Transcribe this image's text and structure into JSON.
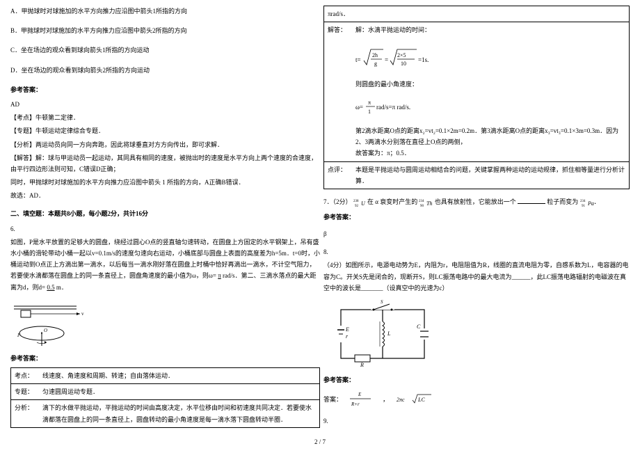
{
  "left": {
    "optA": "A．甲抛球时对球施加的水平方向推力应沿图中箭头1所指的方向",
    "optB": "B．甲抛球时对球施加的水平方向推力应沿图中箭头2所指的方向",
    "optC": "C．坐在场边的观众看到球向箭头1所指的方向运动",
    "optD": "D．坐在场边的观众看到球向箭头2所指的方向运动",
    "answer_label": "参考答案：",
    "answer_val": "AD",
    "exam_point": "【考点】牛顿第二定律．",
    "topic": "【专题】牛顿运动定律综合专题．",
    "analysis": "【分析】两运动员向同一方向奔跑，因此将球垂直对方方向传出，即可求解．",
    "solve1": "【解答】解：球与甲运动员一起运动，其同具有相同的速度，被抛出时的速度是水平方向上两个速度的合速度，由平行四边形法则可知，C错误D正确；",
    "solve2": "同时，甲抛球时对球施加的水平方向推力应沿图中箭头 1 所指的方向，A正确B错误．",
    "conclusion": "故选：AD．",
    "section2": "二、填空题：本题共8小题，每小题2分，共计16分",
    "q6_num": "6.",
    "q6_text": "如图，P是水平放置的足够大的圆盘，绕经过圆心O点的竖直轴匀速转动，在圆盘上方固定的水平钢架上，吊有盛水小桶的滑轮带动小桶一起以v=0.1m/s的速度匀速向右运动，小桶底部与圆盘上表面的高度差为h=5m．t=0时，小桶运动到O点正上方滴出第一滴水，以后每当一滴水刚好落在圆盘上时桶中恰好再滴出一滴水，不计空气阻力，若要使水滴都落在圆盘上的同一条直径上，圆盘角速度的最小值为ω，则ω=",
    "q6_blank1": "π",
    "q6_unit1": "rad/s．第二、三滴水落点的最大距离为d，则d=",
    "q6_blank2": "0.5",
    "q6_unit2": "m．",
    "answer_label2": "参考答案：",
    "t_row1_label": "考点：",
    "t_row1_val": "线速度、角速度和周期、转速；自由落体运动．",
    "t_row2_label": "专题：",
    "t_row2_val": "匀速圆周运动专题．",
    "t_row3_label": "分析：",
    "t_row3_val": "滴下的水做平抛运动，平抛运动的时间由高度决定，水平位移由时间和初速度共同决定．若要使水滴都落在圆盘上的同一条直径上，圆盘转动的最小角速度是每一滴水落下圆盘转动半圈．"
  },
  "right": {
    "pi_rad": "πrad/s．",
    "solve_label": "解答：",
    "solve_text": "解：水滴平抛运动的时间：",
    "formula1": "t=√(2h/g)=√(2×5/10)=1s.",
    "min_angular": "则圆盘的最小角速度：",
    "formula2": "ω=π/1 rad/s=π rad/s．",
    "drop_dist": "第2滴水距离O点的距离x₂=vt₂=0.1×2m=0.2m．第3滴水距离O点的距离x₃=vt₃=0.1×3m=0.3m．因为2、3两滴水分别落在直径上O点的两侧，",
    "conclusion_right": "故答案为：π；0.5．",
    "comment_label": "点评：",
    "comment_val": "本题是平抛运动与圆周运动相结合的问题，关键掌握两种运动的运动规律，抓住相等量进行分析计算．",
    "q7": "7．（2分）",
    "q7_iso1": "在 α 衰变时产生的",
    "q7_text2": "也具有放射性，它能放出一个",
    "q7_blank": "粒子而变为",
    "answer_label3": "参考答案：",
    "answer_beta": "β",
    "q8_num": "8.",
    "q8_text": "（4分）如图所示，电源电动势为E，内阻为r，电阻阻值为R，线圈的直流电阻为零，自感系数为L，电容器的电容为C。开关S先是闭合的，现断开S，则LC振荡电路中的最大电流为______，此LC振荡电路辐射的电磁波在真空中的波长是_______（设真空中的光速为c）",
    "answer_label4": "参考答案：",
    "q9_num": "9.",
    "q9_partial": "答案："
  },
  "pagenum": "2 / 7"
}
